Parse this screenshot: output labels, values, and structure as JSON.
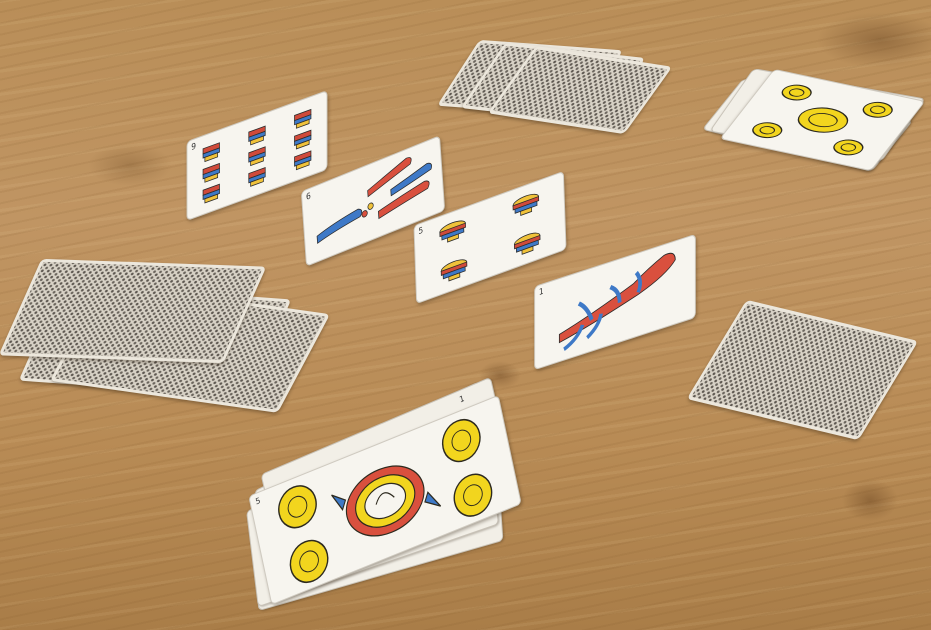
{
  "scene": {
    "surface": "wooden table",
    "colors": {
      "wood": "#b98e58",
      "card_white": "#f7f5ef",
      "card_back_pattern": "#5d5750",
      "club_red": "#d9503e",
      "club_blue": "#3e79c7",
      "coin_yellow": "#f2d51e",
      "cup_yellow": "#f0c23a"
    }
  },
  "cards": {
    "center_row": [
      {
        "suit": "copas",
        "rank": 9
      },
      {
        "suit": "bastos",
        "rank": 6
      },
      {
        "suit": "copas",
        "rank": 5
      },
      {
        "suit": "bastos",
        "rank": 1
      }
    ],
    "bottom_hand_top_card": {
      "suit": "oros",
      "rank": 5
    },
    "top_right_pile_top_card": {
      "suit": "oros",
      "rank": 5
    },
    "bottom_hand_back_card_indices": [
      "5",
      "1"
    ]
  },
  "texts": {
    "center1_index": "9",
    "center2_index": "6",
    "center3_index": "5",
    "center4_index": "1",
    "bottom_card_index": "5",
    "bottom_back_index_a": "5",
    "bottom_back_index_b": "1"
  }
}
